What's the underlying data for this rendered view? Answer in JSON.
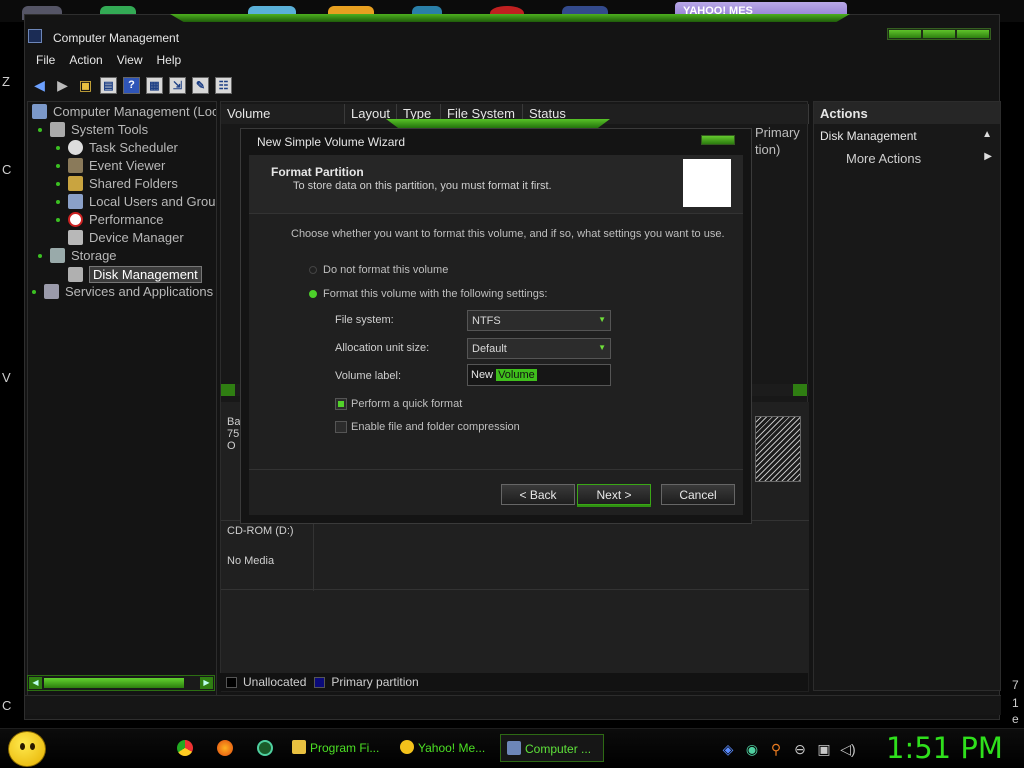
{
  "desktop": {
    "yahoo_tab_label": "YAHOO! MES",
    "left_letters": [
      "Z",
      "C",
      "V",
      "C"
    ],
    "right_digits": [
      "7",
      "1",
      "e"
    ]
  },
  "window": {
    "title": "Computer Management",
    "menu": [
      "File",
      "Action",
      "View",
      "Help"
    ]
  },
  "tree": {
    "items": [
      {
        "label": "Computer Management (Loc",
        "level": 0,
        "icon": "computer-icon"
      },
      {
        "label": "System Tools",
        "level": 1,
        "icon": "tools-icon"
      },
      {
        "label": "Task Scheduler",
        "level": 2,
        "icon": "clock-icon"
      },
      {
        "label": "Event Viewer",
        "level": 2,
        "icon": "event-icon"
      },
      {
        "label": "Shared Folders",
        "level": 2,
        "icon": "folder-icon"
      },
      {
        "label": "Local Users and Grou",
        "level": 2,
        "icon": "users-icon"
      },
      {
        "label": "Performance",
        "level": 2,
        "icon": "performance-icon"
      },
      {
        "label": "Device Manager",
        "level": 2,
        "icon": "device-icon"
      },
      {
        "label": "Storage",
        "level": 1,
        "icon": "storage-icon"
      },
      {
        "label": "Disk Management",
        "level": 2,
        "icon": "disk-icon",
        "selected": true
      },
      {
        "label": "Services and Applications",
        "level": 1,
        "icon": "services-icon"
      }
    ]
  },
  "volume_list": {
    "columns": [
      "Volume",
      "Layout",
      "Type",
      "File System",
      "Status"
    ],
    "status_fragment": [
      "Primary",
      "tion)"
    ]
  },
  "disk_area": {
    "disk0_lines": [
      "Ba",
      "75",
      "O"
    ],
    "cdrom_label": "CD-ROM (D:)",
    "cdrom_status": "No Media"
  },
  "legend": {
    "items": [
      {
        "label": "Unallocated",
        "color": "#000000"
      },
      {
        "label": "Primary partition",
        "color": "#0a0a7a"
      }
    ]
  },
  "actions": {
    "header": "Actions",
    "section": "Disk Management",
    "more": "More Actions"
  },
  "wizard": {
    "title": "New Simple Volume Wizard",
    "heading": "Format Partition",
    "subheading": "To store data on this partition, you must format it first.",
    "intro": "Choose whether you want to format this volume, and if so, what settings you want to use.",
    "option_no_format": "Do not format this volume",
    "option_format": "Format this volume with the following settings:",
    "fs_label": "File system:",
    "fs_value": "NTFS",
    "alloc_label": "Allocation unit size:",
    "alloc_value": "Default",
    "vol_label": "Volume label:",
    "vol_value_a": "New ",
    "vol_value_b": "Volume",
    "quick_format": "Perform a quick format",
    "quick_format_checked": true,
    "compression": "Enable file and folder compression",
    "compression_checked": false,
    "back": "< Back",
    "next": "Next >",
    "cancel": "Cancel"
  },
  "taskbar": {
    "tasks": [
      "Program Fi...",
      "Yahoo! Me...",
      "Computer ..."
    ],
    "clock": "1:51 PM"
  }
}
